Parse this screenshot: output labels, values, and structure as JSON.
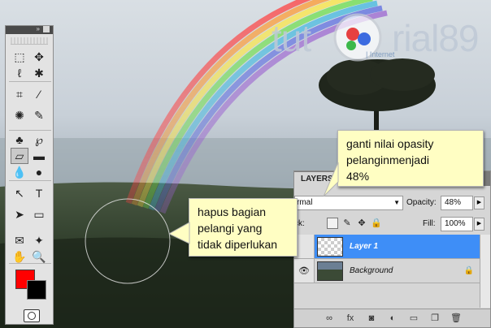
{
  "watermark": {
    "text_left": "tut",
    "text_right": "rial89",
    "sub": "| Internet"
  },
  "toolbox": {
    "title_icon": "double-arrow-icon",
    "tools": [
      {
        "name": "marquee-tool-icon",
        "glyph": "⬚"
      },
      {
        "name": "move-tool-icon",
        "glyph": "✥"
      },
      {
        "name": "lasso-tool-icon",
        "glyph": "ℓ"
      },
      {
        "name": "magic-wand-tool-icon",
        "glyph": "✱"
      },
      {
        "name": "crop-tool-icon",
        "glyph": "⌗"
      },
      {
        "name": "eyedropper-tool-icon",
        "glyph": "⁄"
      },
      {
        "name": "healing-brush-tool-icon",
        "glyph": "✺"
      },
      {
        "name": "brush-tool-icon",
        "glyph": "✎"
      },
      {
        "name": "clone-stamp-tool-icon",
        "glyph": "♣"
      },
      {
        "name": "history-brush-tool-icon",
        "glyph": "℘"
      },
      {
        "name": "eraser-tool-icon",
        "glyph": "▱"
      },
      {
        "name": "gradient-tool-icon",
        "glyph": "▬"
      },
      {
        "name": "blur-tool-icon",
        "glyph": "💧"
      },
      {
        "name": "dodge-tool-icon",
        "glyph": "●"
      },
      {
        "name": "path-selection-tool-icon",
        "glyph": "↖"
      },
      {
        "name": "type-tool-icon",
        "glyph": "T"
      },
      {
        "name": "direct-selection-tool-icon",
        "glyph": "➤"
      },
      {
        "name": "shape-tool-icon",
        "glyph": "▭"
      },
      {
        "name": "notes-tool-icon",
        "glyph": "✉"
      },
      {
        "name": "measure-tool-icon",
        "glyph": "✦"
      },
      {
        "name": "hand-tool-icon",
        "glyph": "✋"
      },
      {
        "name": "zoom-tool-icon",
        "glyph": "🔍"
      }
    ],
    "foreground_color": "#ff0000",
    "background_color": "#000000"
  },
  "layers_panel": {
    "tab_label": "LAYERS",
    "blend_mode": "rmal",
    "opacity_label": "Opacity:",
    "opacity_value": "48%",
    "lock_label": "ck:",
    "fill_label": "Fill:",
    "fill_value": "100%",
    "layers": [
      {
        "name": "Layer 1",
        "active": true,
        "thumb": "transparent"
      },
      {
        "name": "Background",
        "active": false,
        "thumb": "photo"
      }
    ],
    "bottom_icons": [
      "link-icon",
      "fx-icon",
      "mask-icon",
      "adjustment-icon",
      "folder-icon",
      "new-layer-icon",
      "trash-icon"
    ]
  },
  "callouts": {
    "opacity_note": [
      "ganti nilai opasity",
      "pelanginmenjadi",
      "48%"
    ],
    "erase_note": [
      "hapus bagian",
      "pelangi yang",
      "tidak diperlukan"
    ]
  },
  "colors": {
    "selected_layer": "#3e8ef7",
    "callout_bg": "#fffec3"
  }
}
